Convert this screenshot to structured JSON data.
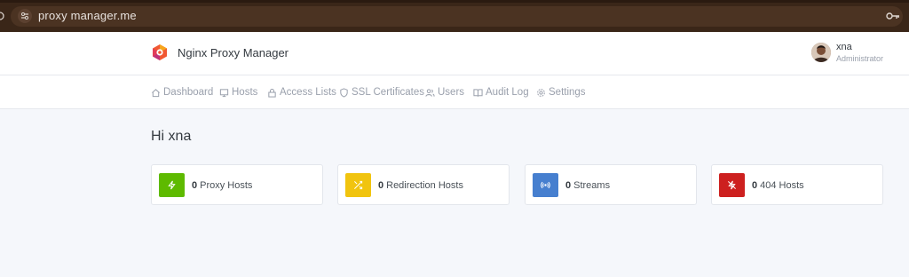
{
  "browser": {
    "url": "proxy manager.me"
  },
  "header": {
    "brand": "Nginx Proxy Manager",
    "user": {
      "name": "xna",
      "role": "Administrator"
    }
  },
  "nav": {
    "items": [
      {
        "label": "Dashboard",
        "icon": "home-icon"
      },
      {
        "label": "Hosts",
        "icon": "monitor-icon"
      },
      {
        "label": "Access Lists",
        "icon": "lock-icon"
      },
      {
        "label": "SSL Certificates",
        "icon": "shield-icon"
      },
      {
        "label": "Users",
        "icon": "users-icon"
      },
      {
        "label": "Audit Log",
        "icon": "book-icon"
      },
      {
        "label": "Settings",
        "icon": "gear-icon"
      }
    ]
  },
  "main": {
    "greeting": "Hi xna",
    "stats": [
      {
        "count": "0",
        "label": "Proxy Hosts",
        "color": "#5eba00",
        "icon": "zap-icon"
      },
      {
        "count": "0",
        "label": "Redirection Hosts",
        "color": "#f1c40f",
        "icon": "shuffle-icon"
      },
      {
        "count": "0",
        "label": "Streams",
        "color": "#467fcf",
        "icon": "radio-icon"
      },
      {
        "count": "0",
        "label": "404 Hosts",
        "color": "#cd201f",
        "icon": "zap-off-icon"
      }
    ]
  }
}
